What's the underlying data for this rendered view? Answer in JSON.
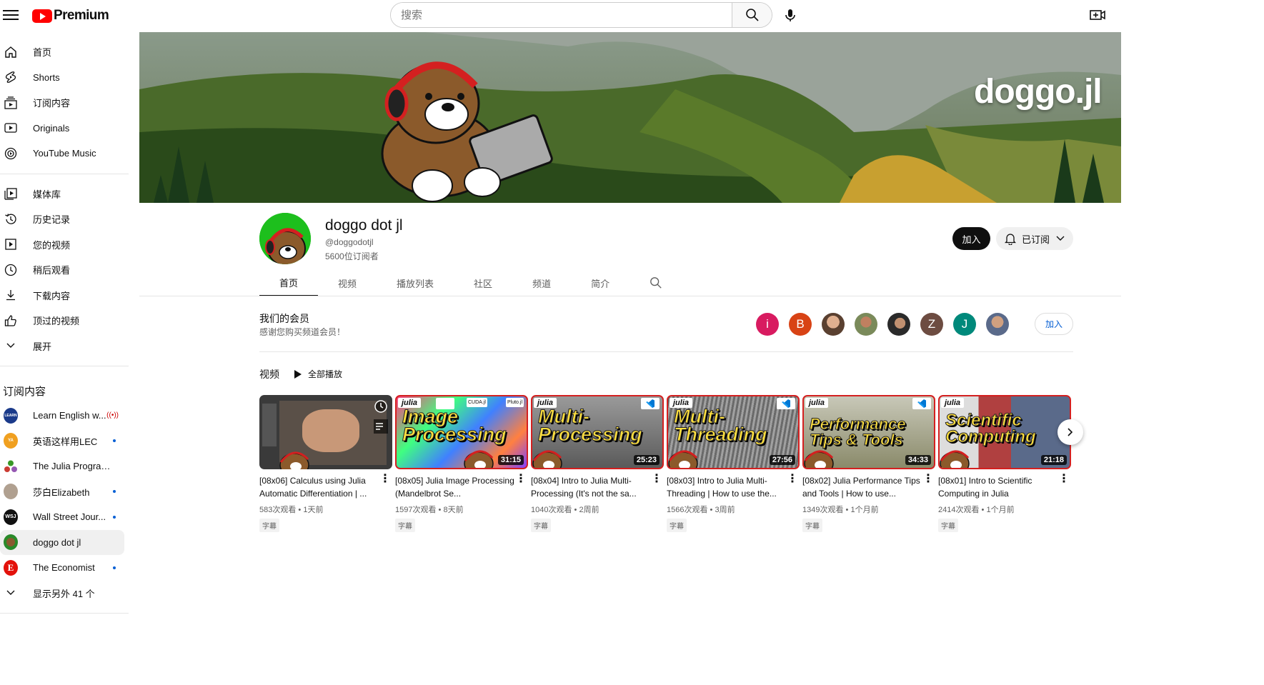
{
  "header": {
    "logo_text": "Premium",
    "search_placeholder": "搜索"
  },
  "sidebar": {
    "main": [
      {
        "label": "首页",
        "icon": "home-icon"
      },
      {
        "label": "Shorts",
        "icon": "shorts-icon"
      },
      {
        "label": "订阅内容",
        "icon": "subscriptions-icon"
      },
      {
        "label": "Originals",
        "icon": "originals-icon"
      },
      {
        "label": "YouTube Music",
        "icon": "music-icon"
      }
    ],
    "library": [
      {
        "label": "媒体库",
        "icon": "library-icon"
      },
      {
        "label": "历史记录",
        "icon": "history-icon"
      },
      {
        "label": "您的视频",
        "icon": "your-videos-icon"
      },
      {
        "label": "稍后观看",
        "icon": "watch-later-icon"
      },
      {
        "label": "下载内容",
        "icon": "download-icon"
      },
      {
        "label": "顶过的视频",
        "icon": "liked-icon"
      },
      {
        "label": "展开",
        "icon": "chevron-down-icon"
      }
    ],
    "subscriptions_title": "订阅内容",
    "subscriptions": [
      {
        "label": "Learn English w...",
        "avatar_color": "#1a3a8a",
        "avatar_text": "LEARN",
        "indicator": "live"
      },
      {
        "label": "英语这样用LEC",
        "avatar_color": "#f0a020",
        "avatar_text": "YA",
        "indicator": "dot"
      },
      {
        "label": "The Julia Program...",
        "avatar_color": "#ffffff",
        "avatar_text": "",
        "indicator": "none"
      },
      {
        "label": "莎白Elizabeth",
        "avatar_color": "#b0a090",
        "avatar_text": "",
        "indicator": "dot"
      },
      {
        "label": "Wall Street Jour...",
        "avatar_color": "#111111",
        "avatar_text": "WSJ",
        "indicator": "dot"
      },
      {
        "label": "doggo dot jl",
        "avatar_color": "#2a8a2a",
        "avatar_text": "",
        "indicator": "none"
      },
      {
        "label": "The Economist",
        "avatar_color": "#e3120b",
        "avatar_text": "E",
        "indicator": "dot"
      }
    ],
    "show_more": "显示另外 41 个"
  },
  "banner": {
    "title": "doggo.jl"
  },
  "channel": {
    "name": "doggo dot jl",
    "handle": "@doggodotjl",
    "subscribers": "5600位订阅者",
    "join_label": "加入",
    "subscribed_label": "已订阅"
  },
  "tabs": [
    "首页",
    "视频",
    "播放列表",
    "社区",
    "频道",
    "简介"
  ],
  "members": {
    "title": "我们的会员",
    "subtitle": "感谢您购买频道会员！",
    "avatars": [
      {
        "letter": "i",
        "color": "#d81b60"
      },
      {
        "letter": "B",
        "color": "#d84315"
      },
      {
        "letter": "",
        "color": "#8a6a50"
      },
      {
        "letter": "",
        "color": "#7a8a5a"
      },
      {
        "letter": "",
        "color": "#3a4a3a"
      },
      {
        "letter": "Z",
        "color": "#6d4c41"
      },
      {
        "letter": "J",
        "color": "#00897b"
      },
      {
        "letter": "",
        "color": "#5a6a8a"
      }
    ],
    "join_label": "加入"
  },
  "videos_section": {
    "title": "视频",
    "play_all": "全部播放"
  },
  "videos": [
    {
      "title": "[08x06] Calculus using Julia Automatic Differentiation | ...",
      "views": "583次观看",
      "age": "1天前",
      "badge": "字幕",
      "duration": "",
      "thumb_text": "",
      "thumb_bg": "#3a3a3a"
    },
    {
      "title": "[08x05] Julia Image Processing (Mandelbrot Se...",
      "views": "1597次观看",
      "age": "8天前",
      "badge": "字幕",
      "duration": "31:15",
      "thumb_text": "Image Processing",
      "thumb_bg": "#8a2be2"
    },
    {
      "title": "[08x04] Intro to Julia Multi-Processing (It's not the sa...",
      "views": "1040次观看",
      "age": "2周前",
      "badge": "字幕",
      "duration": "25:23",
      "thumb_text": "Multi- Processing",
      "thumb_bg": "#7a7a7a"
    },
    {
      "title": "[08x03] Intro to Julia Multi-Threading | How to use the...",
      "views": "1566次观看",
      "age": "3周前",
      "badge": "字幕",
      "duration": "27:56",
      "thumb_text": "Multi- Threading",
      "thumb_bg": "#8a8a8a"
    },
    {
      "title": "[08x02] Julia Performance Tips and Tools | How to use...",
      "views": "1349次观看",
      "age": "1个月前",
      "badge": "字幕",
      "duration": "34:33",
      "thumb_text": "Performance Tips & Tools",
      "thumb_bg": "#9a9a8a"
    },
    {
      "title": "[08x01] Intro to Scientific Computing in Julia",
      "views": "2414次观看",
      "age": "1个月前",
      "badge": "字幕",
      "duration": "21:18",
      "thumb_text": "Scientific Computing",
      "thumb_bg": "#aa3030"
    }
  ]
}
